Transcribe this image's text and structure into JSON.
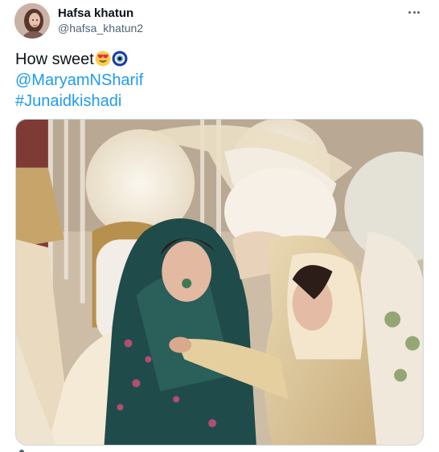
{
  "author": {
    "name": "Hafsa khatun",
    "handle": "@hafsa_khatun2"
  },
  "tweet": {
    "text": "How sweet",
    "emojis": [
      "heart-eyes-emoji",
      "nazar-amulet-emoji"
    ],
    "mention": "@MaryamNSharif",
    "hashtag": "#Junaidkishadi"
  },
  "icons": {
    "more": "more-options-icon"
  },
  "colors": {
    "link": "#1d9bf0",
    "text": "#0f1419",
    "secondary": "#536471"
  }
}
